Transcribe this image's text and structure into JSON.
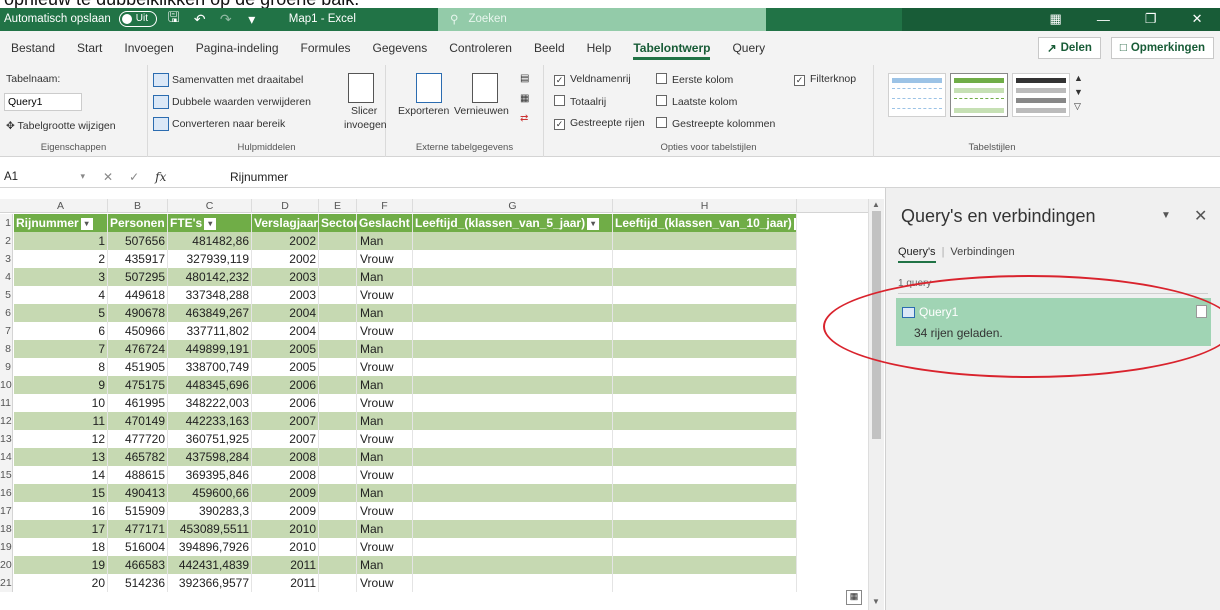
{
  "instruction": "opnieuw te dubbelklikken op de groene balk.",
  "titlebar": {
    "autosave_label": "Automatisch opslaan",
    "autosave_state": "Uit",
    "doc_title": "Map1 - Excel",
    "search_placeholder": "Zoeken"
  },
  "tabs": [
    "Bestand",
    "Start",
    "Invoegen",
    "Pagina-indeling",
    "Formules",
    "Gegevens",
    "Controleren",
    "Beeld",
    "Help",
    "Tabelontwerp",
    "Query"
  ],
  "active_tab": "Tabelontwerp",
  "share_label": "Delen",
  "comments_label": "Opmerkingen",
  "ribbon": {
    "eigenschappen": {
      "tabelnaam_label": "Tabelnaam:",
      "tabelnaam_value": "Query1",
      "resize": "Tabelgrootte wijzigen",
      "group": "Eigenschappen"
    },
    "hulpmiddelen": {
      "pivot": "Samenvatten met draaitabel",
      "dupes": "Dubbele waarden verwijderen",
      "convert": "Converteren naar bereik",
      "slicer_1": "Slicer",
      "slicer_2": "invoegen",
      "group": "Hulpmiddelen"
    },
    "extern": {
      "export": "Exporteren",
      "refresh": "Vernieuwen",
      "group": "Externe tabelgegevens"
    },
    "opties": {
      "header_row": "Veldnamenrij",
      "total_row": "Totaalrij",
      "banded_rows": "Gestreepte rijen",
      "first_col": "Eerste kolom",
      "last_col": "Laatste kolom",
      "banded_cols": "Gestreepte kolommen",
      "filter_btn": "Filterknop",
      "group": "Opties voor tabelstijlen"
    },
    "stijlen": {
      "group": "Tabelstijlen"
    }
  },
  "formula": {
    "namebox": "A1",
    "fx": "fx",
    "value": "Rijnummer"
  },
  "columns": [
    "A",
    "B",
    "C",
    "D",
    "E",
    "F",
    "G",
    "H"
  ],
  "headers": [
    "Rijnummer",
    "Personen",
    "FTE's",
    "Verslagjaar",
    "Sector",
    "Geslacht",
    "Leeftijd_(klassen_van_5_jaar)",
    "Leeftijd_(klassen_van_10_jaar)"
  ],
  "row_numbers": [
    "1",
    "2",
    "3",
    "4",
    "5",
    "6",
    "7",
    "8",
    "9",
    "10",
    "11",
    "12",
    "13",
    "14",
    "15",
    "16",
    "17",
    "18",
    "19",
    "20",
    "21"
  ],
  "rows": [
    [
      "1",
      "507656",
      "481482,86",
      "2002",
      "",
      "Man"
    ],
    [
      "2",
      "435917",
      "327939,119",
      "2002",
      "",
      "Vrouw"
    ],
    [
      "3",
      "507295",
      "480142,232",
      "2003",
      "",
      "Man"
    ],
    [
      "4",
      "449618",
      "337348,288",
      "2003",
      "",
      "Vrouw"
    ],
    [
      "5",
      "490678",
      "463849,267",
      "2004",
      "",
      "Man"
    ],
    [
      "6",
      "450966",
      "337711,802",
      "2004",
      "",
      "Vrouw"
    ],
    [
      "7",
      "476724",
      "449899,191",
      "2005",
      "",
      "Man"
    ],
    [
      "8",
      "451905",
      "338700,749",
      "2005",
      "",
      "Vrouw"
    ],
    [
      "9",
      "475175",
      "448345,696",
      "2006",
      "",
      "Man"
    ],
    [
      "10",
      "461995",
      "348222,003",
      "2006",
      "",
      "Vrouw"
    ],
    [
      "11",
      "470149",
      "442233,163",
      "2007",
      "",
      "Man"
    ],
    [
      "12",
      "477720",
      "360751,925",
      "2007",
      "",
      "Vrouw"
    ],
    [
      "13",
      "465782",
      "437598,284",
      "2008",
      "",
      "Man"
    ],
    [
      "14",
      "488615",
      "369395,846",
      "2008",
      "",
      "Vrouw"
    ],
    [
      "15",
      "490413",
      "459600,66",
      "2009",
      "",
      "Man"
    ],
    [
      "16",
      "515909",
      "390283,3",
      "2009",
      "",
      "Vrouw"
    ],
    [
      "17",
      "477171",
      "453089,5511",
      "2010",
      "",
      "Man"
    ],
    [
      "18",
      "516004",
      "394896,7926",
      "2010",
      "",
      "Vrouw"
    ],
    [
      "19",
      "466583",
      "442431,4839",
      "2011",
      "",
      "Man"
    ],
    [
      "20",
      "514236",
      "392366,9577",
      "2011",
      "",
      "Vrouw"
    ]
  ],
  "pane": {
    "title": "Query's en verbindingen",
    "tab_queries": "Query's",
    "tab_connections": "Verbindingen",
    "count": "1 query",
    "query_name": "Query1",
    "query_info": "34 rijen geladen."
  }
}
